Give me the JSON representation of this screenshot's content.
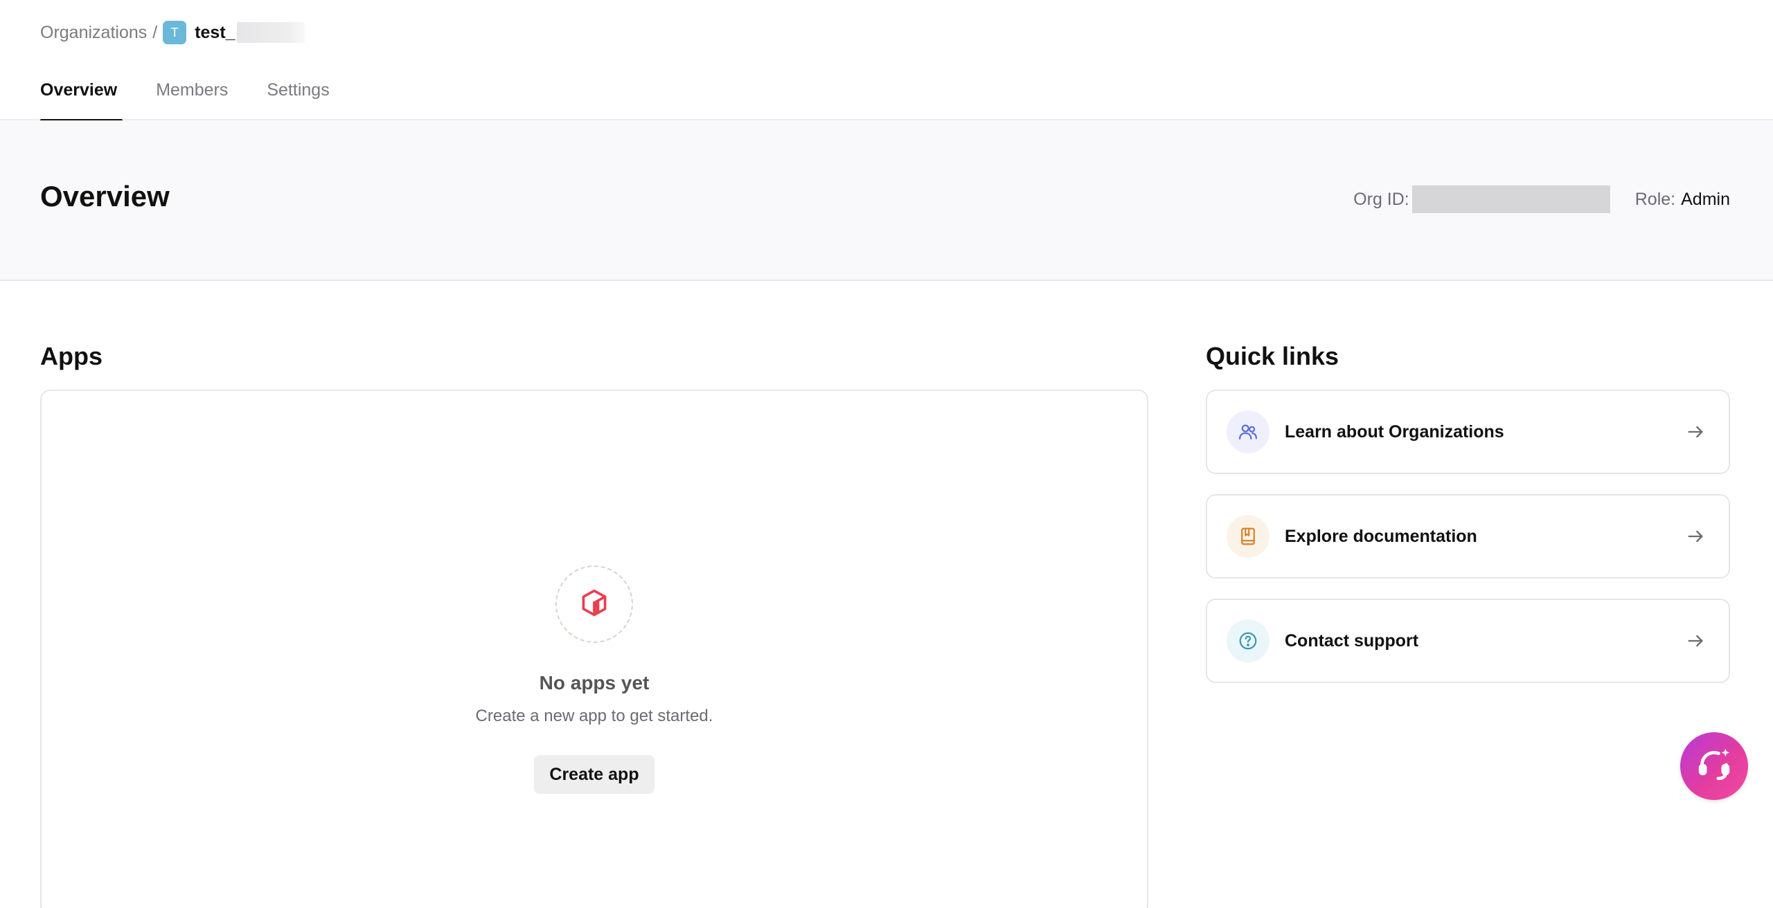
{
  "breadcrumb": {
    "root": "Organizations",
    "separator": "/",
    "org_initial": "T",
    "org_name": "test_"
  },
  "tabs": [
    {
      "label": "Overview",
      "active": true
    },
    {
      "label": "Members",
      "active": false
    },
    {
      "label": "Settings",
      "active": false
    }
  ],
  "header": {
    "title": "Overview",
    "org_id_label": "Org ID:",
    "role_label": "Role:",
    "role_value": "Admin"
  },
  "apps": {
    "title": "Apps",
    "empty_icon": "cube-icon",
    "empty_title": "No apps yet",
    "empty_subtitle": "Create a new app to get started.",
    "create_label": "Create app"
  },
  "quick_links": {
    "title": "Quick links",
    "items": [
      {
        "label": "Learn about Organizations",
        "icon": "users-icon",
        "icon_color": "#5b6ee1",
        "icon_bg": "#eff0fb"
      },
      {
        "label": "Explore documentation",
        "icon": "book-icon",
        "icon_color": "#d9822b",
        "icon_bg": "#fcf3e8"
      },
      {
        "label": "Contact support",
        "icon": "help-circle-icon",
        "icon_color": "#3d98b4",
        "icon_bg": "#eaf6f9"
      }
    ]
  },
  "colors": {
    "accent_apps_icon": "#e8404f",
    "org_badge": "#6bb8d8",
    "fab_gradient_start": "#b63ad8",
    "fab_gradient_end": "#f24aa0"
  },
  "fab": {
    "icon": "support-headset-icon"
  }
}
